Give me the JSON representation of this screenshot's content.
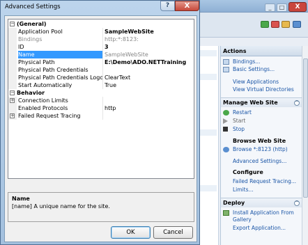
{
  "dialog": {
    "title": "Advanced Settings",
    "help_label": "?",
    "close_label": "X",
    "ok_label": "OK",
    "cancel_label": "Cancel"
  },
  "grid": {
    "rows": [
      {
        "type": "category",
        "expander": "−",
        "name": "(General)"
      },
      {
        "type": "prop",
        "name": "Application Pool",
        "value": "SampleWebSite",
        "bold": true
      },
      {
        "type": "prop",
        "name": "Bindings",
        "value": "http:*:8123:",
        "gray": true
      },
      {
        "type": "prop",
        "name": "ID",
        "value": "3",
        "bold": true
      },
      {
        "type": "prop",
        "name": "Name",
        "value": "SampleWebSite",
        "selected": true,
        "gray_value": true
      },
      {
        "type": "prop",
        "name": "Physical Path",
        "value": "E:\\Demo\\ADO.NETTraining",
        "bold": true
      },
      {
        "type": "prop",
        "name": "Physical Path Credentials",
        "value": ""
      },
      {
        "type": "prop",
        "name": "Physical Path Credentials Logon Type",
        "value": "ClearText"
      },
      {
        "type": "prop",
        "name": "Start Automatically",
        "value": "True"
      },
      {
        "type": "category",
        "expander": "−",
        "name": "Behavior"
      },
      {
        "type": "prop",
        "name": "Connection Limits",
        "value": "",
        "expander": "+"
      },
      {
        "type": "prop",
        "name": "Enabled Protocols",
        "value": "http"
      },
      {
        "type": "prop",
        "name": "Failed Request Tracing",
        "value": "",
        "expander": "+"
      }
    ]
  },
  "description": {
    "title": "Name",
    "text": "[name] A unique name for the site."
  },
  "background": {
    "actions_title": "Actions",
    "close_label": "X",
    "minimize_label": "_",
    "maximize_label": "□",
    "links_top": [
      "Bindings...",
      "Basic Settings...",
      "View Applications",
      "View Virtual Directories"
    ],
    "manage_title": "Manage Web Site",
    "manage_items": [
      "Restart",
      "Start",
      "Stop"
    ],
    "browse_title": "Browse Web Site",
    "browse_link": "Browse *:8123 (http)",
    "advanced_link": "Advanced Settings...",
    "configure_title": "Configure",
    "configure_links": [
      "Failed Request Tracing...",
      "Limits..."
    ],
    "deploy_title": "Deploy",
    "deploy_links": [
      "Install Application From",
      "Gallery",
      "Export Application..."
    ],
    "toggle_up": "^"
  },
  "colors": {
    "selection": "#3399ff",
    "link": "#1a55a6",
    "dialog_frame": "#a3c0de"
  }
}
